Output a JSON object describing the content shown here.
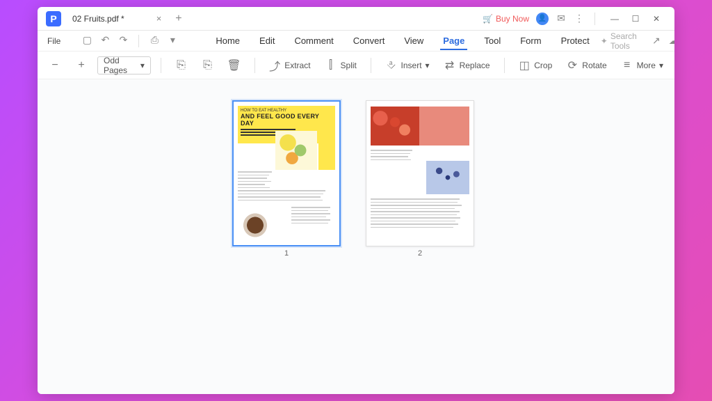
{
  "window": {
    "logo_char": "P",
    "tab_title": "02 Fruits.pdf *",
    "buy_now": "Buy Now"
  },
  "menubar": {
    "file": "File",
    "tabs": [
      "Home",
      "Edit",
      "Comment",
      "Convert",
      "View",
      "Page",
      "Tool",
      "Form",
      "Protect"
    ],
    "active_tab_index": 5,
    "search_placeholder": "Search Tools"
  },
  "toolbar": {
    "dropdown_value": "Odd Pages",
    "extract": "Extract",
    "split": "Split",
    "insert": "Insert",
    "replace": "Replace",
    "crop": "Crop",
    "rotate": "Rotate",
    "more": "More"
  },
  "pages": [
    {
      "num": "1",
      "selected": true,
      "title_small": "HOW TO EAT HEALTHY",
      "title_big": "AND FEEL GOOD EVERY DAY"
    },
    {
      "num": "2",
      "selected": false
    }
  ]
}
